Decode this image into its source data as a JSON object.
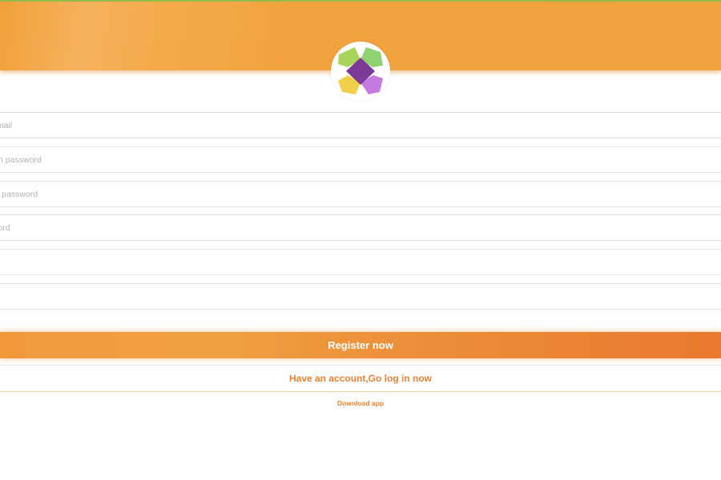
{
  "logo": {
    "icon": "puzzle-cross-logo",
    "colors": {
      "top_left": "#a9d45a",
      "top_right": "#8fd070",
      "bottom_left": "#f0d04a",
      "bottom_right": "#c57ae0",
      "center": "#7a3a96"
    }
  },
  "theme": {
    "header_color": "#f1a33f",
    "accent": "#ea8233"
  },
  "form": {
    "fields": [
      {
        "placeholder": "email",
        "value": ""
      },
      {
        "placeholder": "gin password",
        "value": ""
      },
      {
        "placeholder": "ur password",
        "value": ""
      },
      {
        "placeholder": "word",
        "value": ""
      },
      {
        "placeholder": "",
        "value": ""
      },
      {
        "placeholder": "",
        "value": ""
      }
    ],
    "register_label": "Register now",
    "login_label": "Have an account,Go log in now",
    "download_label": "Download app"
  }
}
